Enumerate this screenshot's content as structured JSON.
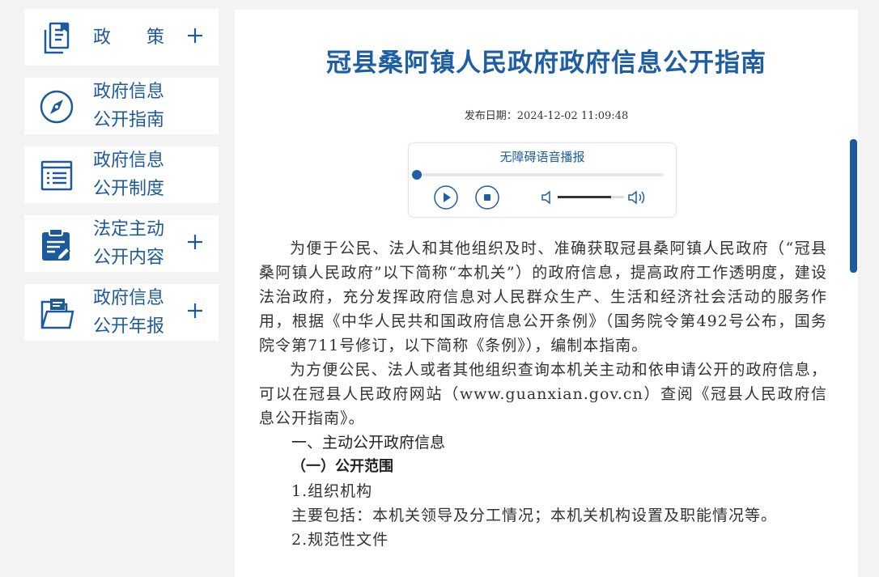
{
  "sidebar": {
    "items": [
      {
        "label_line1": "政　　策",
        "icon": "policy-document-icon",
        "expandable": true
      },
      {
        "label_line1": "政府信息",
        "label_line2": "公开指南",
        "icon": "compass-icon",
        "expandable": false
      },
      {
        "label_line1": "政府信息",
        "label_line2": "公开制度",
        "icon": "list-icon",
        "expandable": false
      },
      {
        "label_line1": "法定主动",
        "label_line2": "公开内容",
        "icon": "clipboard-icon",
        "expandable": true
      },
      {
        "label_line1": "政府信息",
        "label_line2": "公开年报",
        "icon": "folder-icon",
        "expandable": true
      }
    ]
  },
  "article": {
    "title": "冠县桑阿镇人民政府政府信息公开指南",
    "date_label": "发布日期：",
    "date_value": "2024-12-02 11:09:48"
  },
  "player": {
    "title": "无障碍语音播报",
    "progress": 0,
    "volume": 0.8
  },
  "content": {
    "p1": "为便于公民、法人和其他组织及时、准确获取冠县桑阿镇人民政府（“冠县桑阿镇人民政府”以下简称“本机关”）的政府信息，提高政府工作透明度，建设法治政府，充分发挥政府信息对人民群众生产、生活和经济社会活动的服务作用，根据《中华人民共和国政府信息公开条例》（国务院令第492号公布，国务院令第711号修订，以下简称《条例》），编制本指南。",
    "p2": "为方便公民、法人或者其他组织查询本机关主动和依申请公开的政府信息，可以在冠县人民政府网站（www.guanxian.gov.cn）查阅《冠县人民政府信息公开指南》。",
    "h1": "一、主动公开政府信息",
    "h2": "（一）公开范围",
    "item1": "1.组织机构",
    "item1_desc": "主要包括：本机关领导及分工情况；本机关机构设置及职能情况等。",
    "item2": "2.规范性文件"
  },
  "colors": {
    "accent": "#1e5ea5",
    "sidebar_text": "#1d5a9c",
    "background": "#f3f3f3"
  }
}
